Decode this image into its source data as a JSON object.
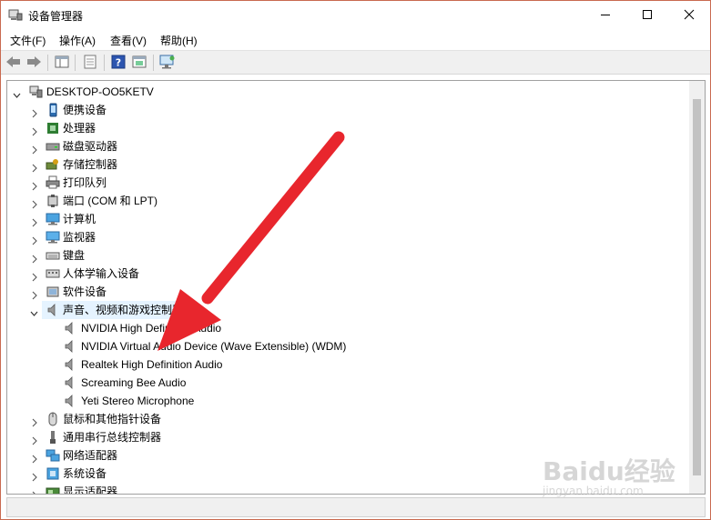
{
  "window": {
    "title": "设备管理器"
  },
  "menu": {
    "file": "文件(F)",
    "action": "操作(A)",
    "view": "查看(V)",
    "help": "帮助(H)"
  },
  "tree": {
    "root": "DESKTOP-OO5KETV",
    "categories": [
      {
        "label": "便携设备",
        "icon": "portable-device-icon"
      },
      {
        "label": "处理器",
        "icon": "processor-icon"
      },
      {
        "label": "磁盘驱动器",
        "icon": "disk-drive-icon"
      },
      {
        "label": "存储控制器",
        "icon": "storage-controller-icon"
      },
      {
        "label": "打印队列",
        "icon": "printer-icon"
      },
      {
        "label": "端口 (COM 和 LPT)",
        "icon": "port-icon"
      },
      {
        "label": "计算机",
        "icon": "computer-icon"
      },
      {
        "label": "监视器",
        "icon": "monitor-icon"
      },
      {
        "label": "键盘",
        "icon": "keyboard-icon"
      },
      {
        "label": "人体学输入设备",
        "icon": "hid-icon"
      },
      {
        "label": "软件设备",
        "icon": "software-device-icon"
      },
      {
        "label": "声音、视频和游戏控制器",
        "icon": "speaker-icon"
      }
    ],
    "audio_devices": [
      "NVIDIA High Definition Audio",
      "NVIDIA Virtual Audio Device (Wave Extensible) (WDM)",
      "Realtek High Definition Audio",
      "Screaming Bee Audio",
      "Yeti Stereo Microphone"
    ],
    "categories_after": [
      {
        "label": "鼠标和其他指针设备",
        "icon": "mouse-icon"
      },
      {
        "label": "通用串行总线控制器",
        "icon": "usb-icon"
      },
      {
        "label": "网络适配器",
        "icon": "network-adapter-icon"
      },
      {
        "label": "系统设备",
        "icon": "system-device-icon"
      },
      {
        "label": "显示适配器",
        "icon": "display-adapter-icon"
      }
    ]
  },
  "watermark": {
    "brand": "Baidu经验",
    "url": "jingyan.baidu.com"
  },
  "colors": {
    "arrow": "#e8262d",
    "selection": "#e5f3ff",
    "title_border": "#c96a50"
  }
}
